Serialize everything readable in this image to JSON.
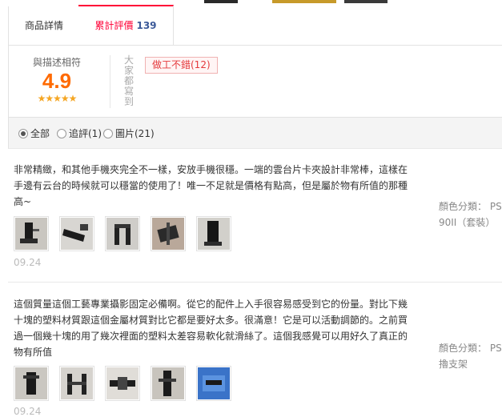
{
  "tabs": [
    {
      "label": "商品詳情"
    },
    {
      "label": "累計評價",
      "count": "139"
    }
  ],
  "summary": {
    "rate_label": "與描述相符",
    "score": "4.9",
    "stars": "★★★★★",
    "vertical_label": "大家都寫到",
    "tags": [
      {
        "text": "做工不錯(12)"
      }
    ]
  },
  "filters": [
    {
      "label": "全部",
      "selected": true
    },
    {
      "label": "追評(1)",
      "selected": false
    },
    {
      "label": "圖片(21)",
      "selected": false
    }
  ],
  "reviews": [
    {
      "text": "非常精緻，和其他手機夾完全不一樣，安放手機很穩。一端的雲台片卡夾設計非常棒，這樣在手邊有云台的時候就可以穩當的使用了！唯一不足就是價格有點高，但是屬於物有所值的那種高~",
      "sku_label": "顏色分類：",
      "sku_value": "PS-90II（套裝）",
      "date": "09.24"
    },
    {
      "text": "這個質量這個工藝專業攝影固定必備啊。從它的配件上入手很容易感受到它的份量。對比下幾十塊的塑料材質跟這個金屬材質對比它都是要好太多。很滿意！它是可以活動調節的。之前買過一個幾十塊的用了幾次裡面的塑料太差容易軟化就滑絲了。這個我感覺可以用好久了真正的物有所值",
      "sku_label": "顏色分類：",
      "sku_value": "PS-擼支架",
      "date": "09.24"
    }
  ]
}
